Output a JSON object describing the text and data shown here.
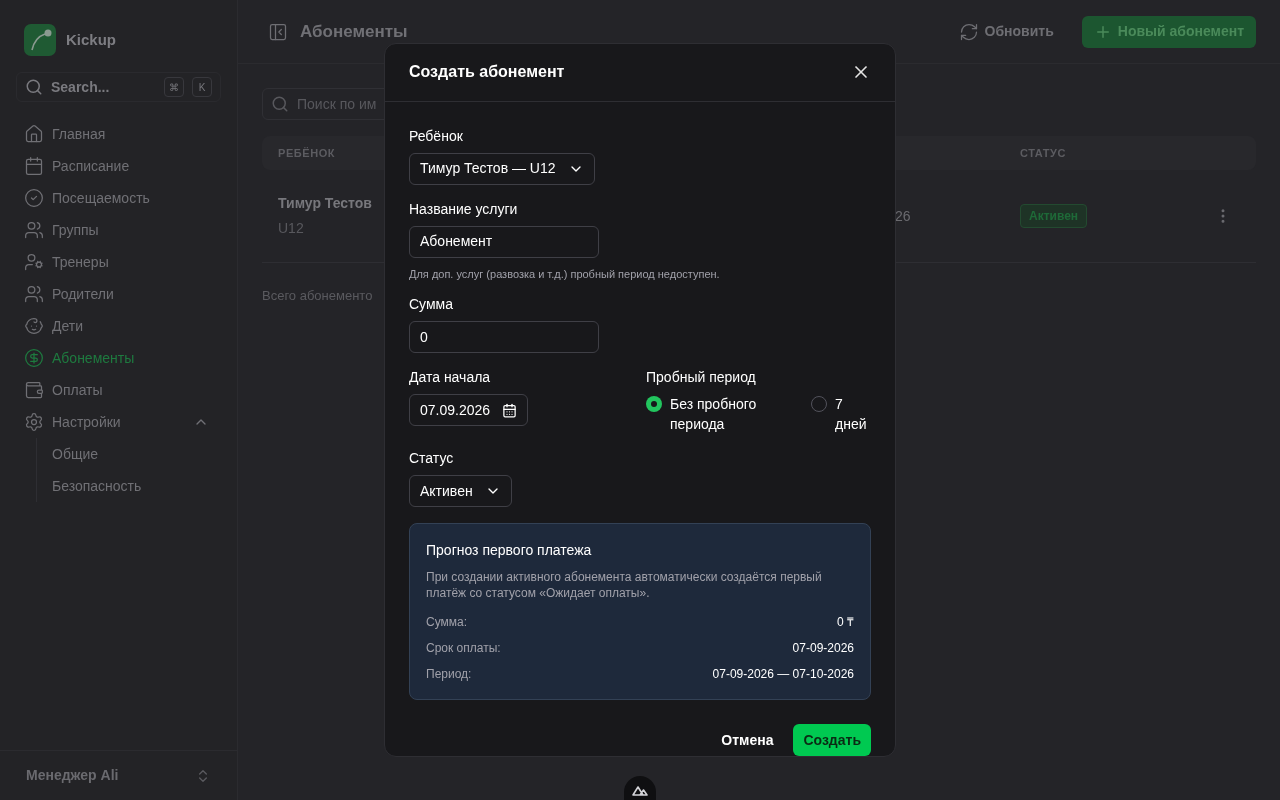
{
  "app": {
    "name": "Kickup"
  },
  "sidebar": {
    "search": {
      "placeholder": "Search...",
      "keys": [
        "⌘",
        "K"
      ]
    },
    "items": [
      {
        "label": "Главная",
        "selected": false
      },
      {
        "label": "Расписание",
        "selected": false
      },
      {
        "label": "Посещаемость",
        "selected": false
      },
      {
        "label": "Группы",
        "selected": false
      },
      {
        "label": "Тренеры",
        "selected": false
      },
      {
        "label": "Родители",
        "selected": false
      },
      {
        "label": "Дети",
        "selected": false
      },
      {
        "label": "Абонементы",
        "selected": true
      },
      {
        "label": "Оплаты",
        "selected": false
      },
      {
        "label": "Настройки",
        "selected": false,
        "expanded": true,
        "children": [
          {
            "label": "Общие",
            "selected": false
          },
          {
            "label": "Безопасность",
            "selected": false
          }
        ]
      }
    ],
    "user": "Менеджер Ali"
  },
  "header": {
    "title": "Абонементы",
    "refresh": "Обновить",
    "new": "Новый абонемент"
  },
  "page": {
    "search": {
      "placeholder": "Поиск по им"
    },
    "table": {
      "columns": [
        "РЕБЁНОК",
        "СТАТУС"
      ],
      "rows": [
        {
          "name": "Тимур Тестов",
          "group": "U12",
          "column_2": "26",
          "status": "Активен"
        }
      ]
    },
    "total": "Всего абонементо"
  },
  "dialog": {
    "title": "Создать абонемент",
    "child": {
      "label": "Ребёнок",
      "value": "Тимур Тестов — U12"
    },
    "service": {
      "label": "Название услуги",
      "value": "Абонемент",
      "hint": "Для доп. услуг (развозка и т.д.) пробный период недоступен."
    },
    "amount": {
      "label": "Сумма",
      "value": "0"
    },
    "start": {
      "label": "Дата начала",
      "value": "07.09.2026"
    },
    "trial": {
      "label": "Пробный период",
      "options": [
        {
          "label": "Без пробного периода",
          "selected": true
        },
        {
          "label": "7 дней",
          "selected": false
        }
      ]
    },
    "status": {
      "label": "Статус",
      "value": "Активен"
    },
    "forecast": {
      "title": "Прогноз первого платежа",
      "text": "При создании активного абонемента автоматически создаётся первый платёж со статусом «Ожидает оплаты».",
      "rows": [
        {
          "label": "Сумма:",
          "value": "0 ₸"
        },
        {
          "label": "Срок оплаты:",
          "value": "07-09-2026"
        },
        {
          "label": "Период:",
          "value": "07-09-2026 — 07-10-2026"
        }
      ]
    },
    "buttons": {
      "cancel": "Отмена",
      "create": "Создать"
    }
  }
}
